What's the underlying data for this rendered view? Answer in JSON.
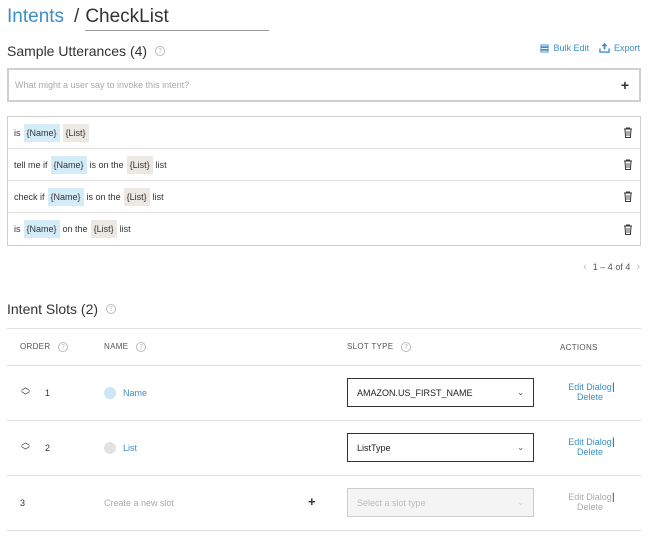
{
  "breadcrumb": {
    "parent": "Intents",
    "separator": "/",
    "current": "CheckList"
  },
  "utterances": {
    "title": "Sample Utterances (4)",
    "bulk_edit": "Bulk Edit",
    "export": "Export",
    "placeholder": "What might a user say to invoke this intent?",
    "add_symbol": "+",
    "rows": [
      {
        "parts": [
          [
            "t",
            "is"
          ],
          [
            "n",
            "{Name}"
          ],
          [
            "l",
            "{List}"
          ]
        ]
      },
      {
        "parts": [
          [
            "t",
            "tell me if"
          ],
          [
            "n",
            "{Name}"
          ],
          [
            "t",
            "is on the"
          ],
          [
            "l",
            "{List}"
          ],
          [
            "t",
            "list"
          ]
        ]
      },
      {
        "parts": [
          [
            "t",
            "check if"
          ],
          [
            "n",
            "{Name}"
          ],
          [
            "t",
            "is on the"
          ],
          [
            "l",
            "{List}"
          ],
          [
            "t",
            "list"
          ]
        ]
      },
      {
        "parts": [
          [
            "t",
            "is"
          ],
          [
            "n",
            "{Name}"
          ],
          [
            "t",
            "on the"
          ],
          [
            "l",
            "{List}"
          ],
          [
            "t",
            "list"
          ]
        ]
      }
    ],
    "pagination": "1 – 4 of 4"
  },
  "slots": {
    "title": "Intent Slots (2)",
    "headers": {
      "order": "ORDER",
      "name": "NAME",
      "slot_type": "SLOT TYPE",
      "actions": "ACTIONS"
    },
    "rows": [
      {
        "order": "1",
        "name": "Name",
        "slot_type": "AMAZON.US_FIRST_NAME",
        "dot_color": "#cde6f7",
        "edit": "Edit Dialog",
        "delete": "Delete"
      },
      {
        "order": "2",
        "name": "List",
        "slot_type": "ListType",
        "dot_color": "#e4e2e0",
        "edit": "Edit Dialog",
        "delete": "Delete"
      }
    ],
    "new_row": {
      "order": "3",
      "placeholder": "Create a new slot",
      "add_symbol": "+",
      "slot_type_placeholder": "Select a slot type",
      "edit": "Edit Dialog",
      "delete": "Delete"
    }
  },
  "colors": {
    "accent": "#3b8fc9",
    "name_token": "#d4ecf8",
    "list_token": "#ece8e4"
  }
}
